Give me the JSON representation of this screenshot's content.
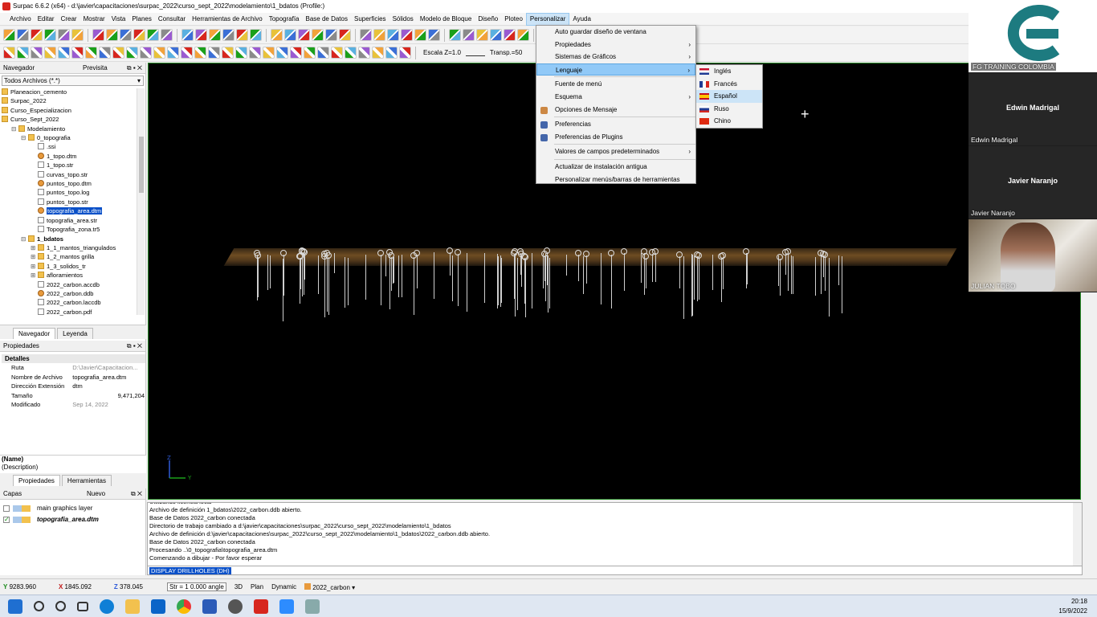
{
  "window": {
    "title": "Surpac 6.6.2 (x64) - d:\\javier\\capacitaciones\\surpac_2022\\curso_sept_2022\\modelamiento\\1_bdatos (Profile:)"
  },
  "menubar": [
    "Archivo",
    "Editar",
    "Crear",
    "Mostrar",
    "Vista",
    "Planes",
    "Consultar",
    "Herramientas de Archivo",
    "Topografía",
    "Base de Datos",
    "Superficies",
    "Sólidos",
    "Modelo de Bloque",
    "Diseño",
    "Ploteo",
    "Personalizar",
    "Ayuda"
  ],
  "toolbar": {
    "scale_label": "Escala Z=1.0",
    "transp_label": "Transp.=50"
  },
  "navigator": {
    "title": "Navegador",
    "preview": "Previsita",
    "filter": "Todos Archivos (*.*)",
    "tree": [
      "Planeacion_cemento",
      "Surpac_2022",
      "Curso_Especializacion",
      "Curso_Sept_2022",
      "Modelamiento",
      "0_topografia",
      ".ssi",
      "1_topo.dtm",
      "1_topo.str",
      "curvas_topo.str",
      "puntos_topo.dtm",
      "puntos_topo.log",
      "puntos_topo.str",
      "topografia_area.dtm",
      "topografia_area.str",
      "Topografia_zona.tr5",
      "1_bdatos",
      "1_1_mantos_triangulados",
      "1_2_mantos grilla",
      "1_3_solidos_tr",
      "afloramientos",
      "2022_carbon.accdb",
      "2022_carbon.ddb",
      "2022_carbon.laccdb",
      "2022_carbon.pdf"
    ],
    "tabs": [
      "Navegador",
      "Leyenda"
    ]
  },
  "properties": {
    "title": "Propiedades",
    "group": "Detalles",
    "rows": [
      {
        "k": "Ruta",
        "v": "D:\\Javier\\Capacitacion..."
      },
      {
        "k": "Nombre de Archivo",
        "v": "topografia_area.dtm"
      },
      {
        "k": "Dirección Extensión",
        "v": "dtm"
      },
      {
        "k": "Tamaño",
        "v": "9,471,204"
      },
      {
        "k": "Modificado",
        "v": "Sep 14, 2022"
      }
    ],
    "desc_name": "(Name)",
    "desc_text": "(Description)",
    "tabs": [
      "Propiedades",
      "Herramientas"
    ]
  },
  "layers": {
    "title": "Capas",
    "new": "Nuevo",
    "items": [
      "main graphics layer",
      "topografia_area.dtm"
    ]
  },
  "personalizar_menu": [
    "Auto guardar diseño de ventana",
    "Propiedades",
    "Sistemas de Gráficos",
    "Lenguaje",
    "Fuente de menú",
    "Esquema",
    "Opciones de Mensaje",
    "Preferencias",
    "Preferencias de Plugins",
    "Valores de campos predeterminados",
    "Actualizar de instalación antigua",
    "Personalizar menús/barras de herramientas"
  ],
  "language_menu": [
    "Inglés",
    "Francés",
    "Español",
    "Ruso",
    "Chino"
  ],
  "console": {
    "lines": [
      "Utilizando licencia local",
      "Archivo de definición 1_bdatos\\2022_carbon.ddb abierto.",
      "Base de Datos 2022_carbon conectada",
      "Directorio de trabajo cambiado a d:\\javier\\capacitaciones\\surpac_2022\\curso_sept_2022\\modelamiento\\1_bdatos",
      "Archivo de definición d:\\javier\\capacitaciones\\surpac_2022\\curso_sept_2022\\modelamiento\\1_bdatos\\2022_carbon.ddb abierto.",
      "Base de Datos 2022_carbon conectada",
      "Procesando ..\\0_topografia\\topografia_area.dtm",
      "Comenzando a dibujar - Por favor esperar"
    ],
    "command": "DISPLAY DRILLHOLES (DH)"
  },
  "status": {
    "y": "9283.960",
    "x": "1845.092",
    "z": "378.045",
    "str": "Str = 1",
    "angle": "0.000 angle",
    "mode3d": "3D",
    "plan": "Plan",
    "dynamic": "Dynamic",
    "db": "2022_carbon"
  },
  "video": {
    "logo_caption": "FG TRAINING COLOMBIA",
    "p1": "Edwin Madrigal",
    "p2": "Javier Naranjo",
    "p3": "JULIAN TOBO"
  },
  "clock": {
    "time": "20:18",
    "date": "15/9/2022"
  }
}
